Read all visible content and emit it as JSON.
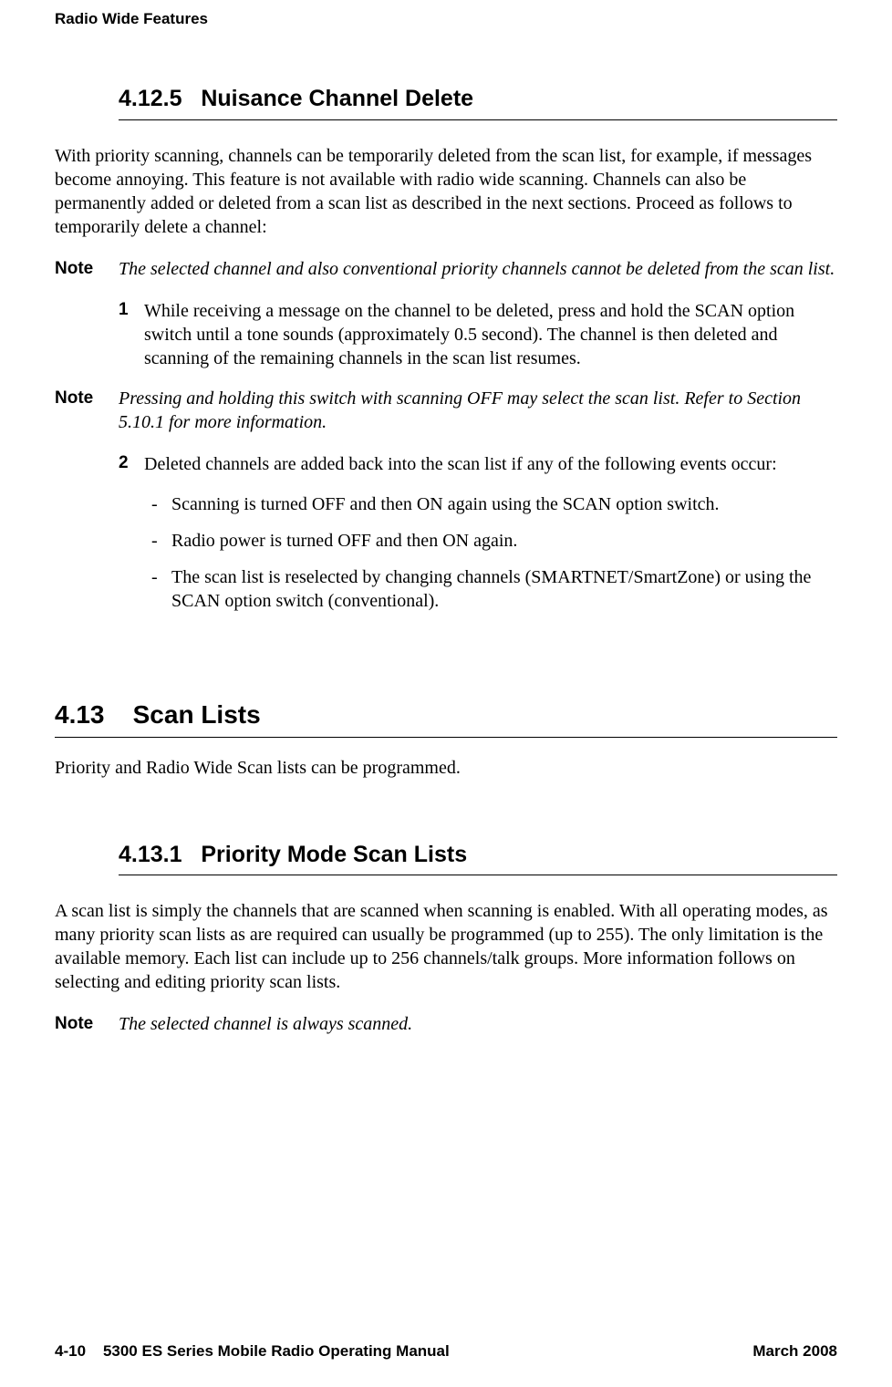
{
  "header": {
    "title": "Radio Wide Features"
  },
  "sections": {
    "s1": {
      "number": "4.12.5",
      "title": "Nuisance Channel Delete",
      "intro": "With priority scanning, channels can be temporarily deleted from the scan list, for example, if messages become annoying. This feature is not available with radio wide scanning. Channels can also be permanently added or deleted from a scan list as described in the next sections. Proceed as follows to temporarily delete a channel:",
      "note1_label": "Note",
      "note1_text": "The selected channel and also conventional priority channels cannot be deleted from the scan list.",
      "step1_num": "1",
      "step1_text": "While receiving a message on the channel to be deleted, press and hold the SCAN option switch until a tone sounds (approximately 0.5 second). The channel is then deleted and scanning of the remaining channels in the scan list resumes.",
      "note2_label": "Note",
      "note2_text": "Pressing and holding this switch with scanning OFF may select the scan list. Refer to Section 5.10.1 for more information.",
      "step2_num": "2",
      "step2_text": "Deleted channels are added back into the scan list if any of the following events occur:",
      "bullets": {
        "b1": "Scanning is turned OFF and then ON again using the SCAN option switch.",
        "b2": "Radio power is turned OFF and then ON again.",
        "b3": "The scan list is reselected by changing channels (SMARTNET/SmartZone) or using the SCAN option switch (conventional)."
      }
    },
    "s2": {
      "number": "4.13",
      "title": "Scan Lists",
      "intro": "Priority and Radio Wide Scan lists can be programmed."
    },
    "s3": {
      "number": "4.13.1",
      "title": "Priority Mode Scan Lists",
      "intro": "A scan list is simply the channels that are scanned when scanning is enabled. With all operating modes, as many priority scan lists as are required can usually be programmed (up to 255). The only limitation is the available memory. Each list can include up to 256 channels/talk groups. More information follows on selecting and editing priority scan lists.",
      "note_label": "Note",
      "note_text": "The selected channel is always scanned."
    }
  },
  "footer": {
    "left_page": "4-10",
    "left_title": "5300 ES Series Mobile Radio Operating Manual",
    "right": "March 2008"
  },
  "dash_char": "-"
}
